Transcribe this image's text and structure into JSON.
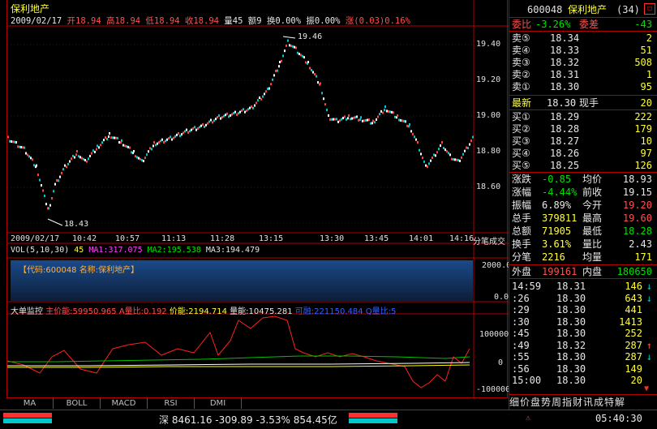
{
  "chart_title": "保利地产",
  "info_bar": {
    "date": "2009/02/17",
    "open": "开18.94",
    "high": "高18.94",
    "low": "低18.94",
    "close": "收18.94",
    "volume": "量45",
    "amount": "额9",
    "turnover": "换0.00%",
    "amplitude": "振0.00%",
    "change": "涨(0.03)0.16%"
  },
  "price_axis": [
    "19.40",
    "19.20",
    "19.00",
    "18.80",
    "18.60"
  ],
  "high_label": "19.46",
  "low_label": "18.43",
  "time_axis": [
    "2009/02/17",
    "10:42",
    "10:57",
    "11:13",
    "11:28",
    "13:15",
    "13:30",
    "13:45",
    "14:01",
    "14:16",
    "分笔成交"
  ],
  "vol_bar": {
    "label": "VOL(5,10,30)",
    "v": "45",
    "ma1": "MA1:317.075",
    "ma2": "MA2:195.538",
    "ma3": "MA3:194.479"
  },
  "vol_axis": [
    "2000.0",
    "0.0"
  ],
  "vol_code": "【代码:600048 名称:保利地产】",
  "big_order": {
    "label": "大单监控",
    "main": "主价能:59950.965",
    "aratio": "A量比:0.192",
    "price": "价能:2194.714",
    "vol": "量能:10475.281",
    "hidden": "可融:221150.484",
    "qratio": "Q量比:5"
  },
  "big_axis": [
    "100000",
    "0",
    "-100000"
  ],
  "tabs": [
    "MA",
    "BOLL",
    "MACD",
    "RSI",
    "DMI"
  ],
  "quote": {
    "code": "600048",
    "name": "保利地产",
    "id": "(34)",
    "webi_label": "委比",
    "webi": "-3.26%",
    "wecha_label": "委差",
    "wecha": "-43",
    "sells": [
      {
        "l": "卖⑤",
        "p": "18.34",
        "v": "2"
      },
      {
        "l": "卖④",
        "p": "18.33",
        "v": "51"
      },
      {
        "l": "卖③",
        "p": "18.32",
        "v": "508"
      },
      {
        "l": "卖②",
        "p": "18.31",
        "v": "1"
      },
      {
        "l": "卖①",
        "p": "18.30",
        "v": "95"
      }
    ],
    "latest_label": "最新",
    "latest": "18.30",
    "xianshou_label": "现手",
    "xianshou": "20",
    "buys": [
      {
        "l": "买①",
        "p": "18.29",
        "v": "222"
      },
      {
        "l": "买②",
        "p": "18.28",
        "v": "179"
      },
      {
        "l": "买③",
        "p": "18.27",
        "v": "10"
      },
      {
        "l": "买④",
        "p": "18.26",
        "v": "97"
      },
      {
        "l": "买⑤",
        "p": "18.25",
        "v": "126"
      }
    ],
    "stats": [
      {
        "a": "涨跌",
        "b": "-0.85",
        "c": "均价",
        "d": "18.93"
      },
      {
        "a": "涨幅",
        "b": "-4.44%",
        "c": "前收",
        "d": "19.15"
      },
      {
        "a": "振幅",
        "b": "6.89%",
        "c": "今开",
        "d": "19.20"
      },
      {
        "a": "总手",
        "b": "379811",
        "c": "最高",
        "d": "19.60"
      },
      {
        "a": "总额",
        "b": "71905",
        "c": "最低",
        "d": "18.28"
      },
      {
        "a": "换手",
        "b": "3.61%",
        "c": "量比",
        "d": "2.43"
      },
      {
        "a": "分笔",
        "b": "2216",
        "c": "均量",
        "d": "171"
      }
    ],
    "outer_label": "外盘",
    "outer": "199161",
    "inner_label": "内盘",
    "inner": "180650",
    "ticks": [
      {
        "t": "14:59",
        "p": "18.31",
        "v": "146",
        "arrow": "↓"
      },
      {
        "t": ":26",
        "p": "18.30",
        "v": "643",
        "arrow": "↓"
      },
      {
        "t": ":29",
        "p": "18.30",
        "v": "441",
        "arrow": ""
      },
      {
        "t": ":30",
        "p": "18.30",
        "v": "1413",
        "arrow": ""
      },
      {
        "t": ":45",
        "p": "18.30",
        "v": "252",
        "arrow": ""
      },
      {
        "t": ":49",
        "p": "18.32",
        "v": "287",
        "arrow": "↑"
      },
      {
        "t": ":55",
        "p": "18.30",
        "v": "287",
        "arrow": "↓"
      },
      {
        "t": ":56",
        "p": "18.30",
        "v": "149",
        "arrow": ""
      },
      {
        "t": "15:00",
        "p": "18.30",
        "v": "20",
        "arrow": ""
      }
    ],
    "bottom_tabs": "细价盘势周指财讯成特解"
  },
  "status_bar": {
    "market": "深",
    "index": "8461.16",
    "change": "-309.89",
    "pct": "-3.53%",
    "amount": "854.45亿",
    "clock": "05:40:30"
  }
}
